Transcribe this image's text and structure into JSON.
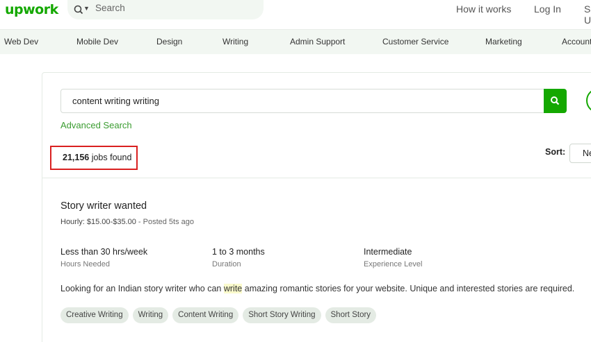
{
  "header": {
    "logo": "upwork",
    "search_placeholder": "Search",
    "links": [
      "How it works",
      "Log In",
      "Sign Up"
    ]
  },
  "categories": [
    "Web Dev",
    "Mobile Dev",
    "Design",
    "Writing",
    "Admin Support",
    "Customer Service",
    "Marketing",
    "Accounting"
  ],
  "search": {
    "query": "content writing writing",
    "advanced_label": "Advanced Search"
  },
  "results": {
    "count": "21,156",
    "count_suffix": " jobs found",
    "sort_label": "Sort:",
    "sort_value": "Newest"
  },
  "job": {
    "title": "Story writer wanted",
    "rate": "Hourly: $15.00-$35.00",
    "posted": " - Posted 5ts ago",
    "stats": [
      {
        "value": "Less than 30 hrs/week",
        "label": "Hours Needed"
      },
      {
        "value": "1 to 3 months",
        "label": "Duration"
      },
      {
        "value": "Intermediate",
        "label": "Experience Level"
      }
    ],
    "description_before": "Looking for an Indian story writer who can ",
    "description_highlight": "write",
    "description_after": " amazing romantic stories for your website. Unique and interested stories are required.",
    "tags": [
      "Creative Writing",
      "Writing",
      "Content Writing",
      "Short Story Writing",
      "Short Story"
    ]
  },
  "colors": {
    "brand": "#14a800",
    "highlight_box": "#d92020"
  }
}
